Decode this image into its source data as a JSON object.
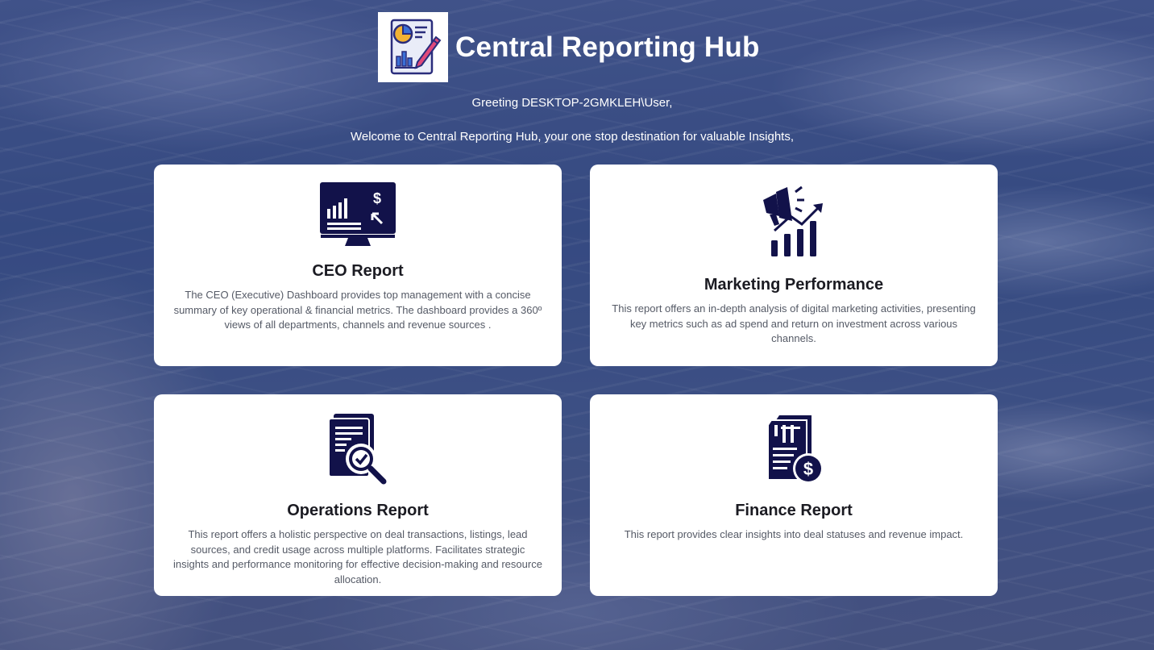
{
  "header": {
    "title": "Central Reporting Hub",
    "greeting": "Greeting DESKTOP-2GMKLEH\\User,",
    "welcome": "Welcome to Central Reporting Hub, your one stop destination for valuable Insights,"
  },
  "cards": [
    {
      "title": "CEO Report",
      "icon": "monitor-chart-dollar-icon",
      "description": "The CEO (Executive) Dashboard provides top management with a concise summary of key operational & financial metrics. The dashboard provides a 360º views of all departments, channels and revenue sources ."
    },
    {
      "title": "Marketing Performance",
      "icon": "megaphone-growth-chart-icon",
      "description": "This report offers an in-depth analysis of digital marketing activities, presenting key metrics such as ad spend and return on investment across various channels."
    },
    {
      "title": "Operations Report",
      "icon": "document-magnifier-check-icon",
      "description": "This report offers a holistic perspective on deal transactions, listings, lead sources, and credit usage across multiple platforms. Facilitates strategic insights and performance monitoring for effective decision-making and resource allocation."
    },
    {
      "title": "Finance Report",
      "icon": "invoice-dollar-icon",
      "description": "This report provides clear insights into deal statuses and revenue impact."
    }
  ],
  "colors": {
    "icon_navy": "#12124a",
    "card_bg": "#ffffff",
    "title_text": "#1b1b22",
    "body_text": "#555a66"
  }
}
